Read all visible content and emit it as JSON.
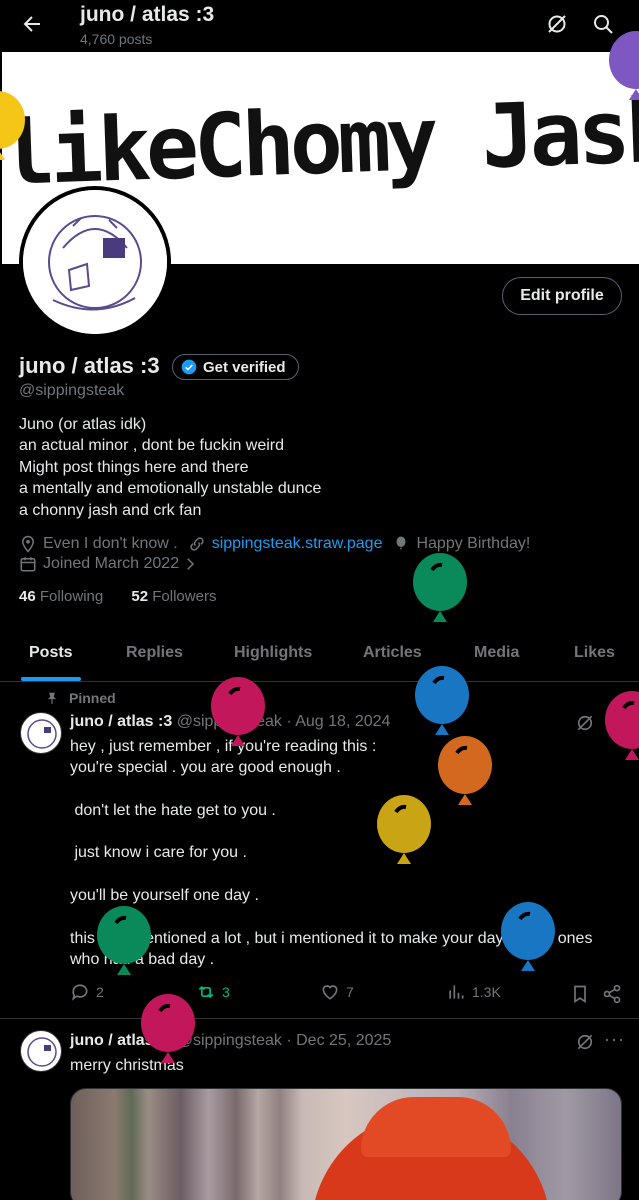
{
  "header": {
    "title": "juno / atlas :3",
    "post_count": "4,760 posts"
  },
  "banner": {
    "text": "likeChomy Jash"
  },
  "profile": {
    "name": "juno / atlas :3",
    "verify_label": "Get verified",
    "handle": "@sippingsteak",
    "edit_label": "Edit profile",
    "bio": [
      "Juno (or atlas idk)",
      "an actual minor , dont be fuckin weird",
      "Might post things here and there",
      "a mentally and emotionally unstable dunce",
      "a chonny jash and crk fan"
    ],
    "location": "Even I don't know .",
    "website": "sippingsteak.straw.page",
    "birthday": "Happy Birthday!",
    "joined": "Joined March 2022",
    "following_count": "46",
    "following_label": "Following",
    "followers_count": "52",
    "followers_label": "Followers"
  },
  "tabs": [
    {
      "label": "Posts",
      "active": true
    },
    {
      "label": "Replies"
    },
    {
      "label": "Highlights"
    },
    {
      "label": "Articles"
    },
    {
      "label": "Media"
    },
    {
      "label": "Likes"
    }
  ],
  "posts": [
    {
      "pinned_label": "Pinned",
      "name": "juno / atlas :3",
      "handle": "@sippingsteak",
      "date": "Aug 18, 2024",
      "lines": [
        "hey , just remember , if you're reading this :",
        "you're special . you are good enough .",
        "",
        " don't let the hate get to you .",
        "",
        " just know i care for you .",
        "",
        "you'll be yourself one day .",
        "",
        "this isn't mentioned a lot , but i mentioned it to make your day for the ones",
        "who had a bad day ."
      ],
      "replies": "2",
      "reposts": "3",
      "likes": "7",
      "views": "1.3K"
    },
    {
      "name": "juno / atlas :3",
      "handle": "@sippingsteak",
      "date": "Dec 25, 2025",
      "text": "merry christmas"
    }
  ],
  "colors": {
    "accent": "#1d9bf0",
    "muted": "#71767b",
    "repost_green": "#00ba7c",
    "balloons": [
      "#0a8a5a",
      "#c2185b",
      "#1976c2",
      "#d2691e",
      "#c9a414",
      "#7e57c2",
      "#f5c518"
    ]
  },
  "icons": [
    "back-arrow-icon",
    "grok-icon",
    "search-icon",
    "verified-badge-icon",
    "location-icon",
    "link-icon",
    "balloon-icon",
    "calendar-icon",
    "chevron-right-icon",
    "pin-icon",
    "reply-icon",
    "repost-icon",
    "like-icon",
    "views-icon",
    "bookmark-icon",
    "share-icon",
    "more-icon"
  ]
}
